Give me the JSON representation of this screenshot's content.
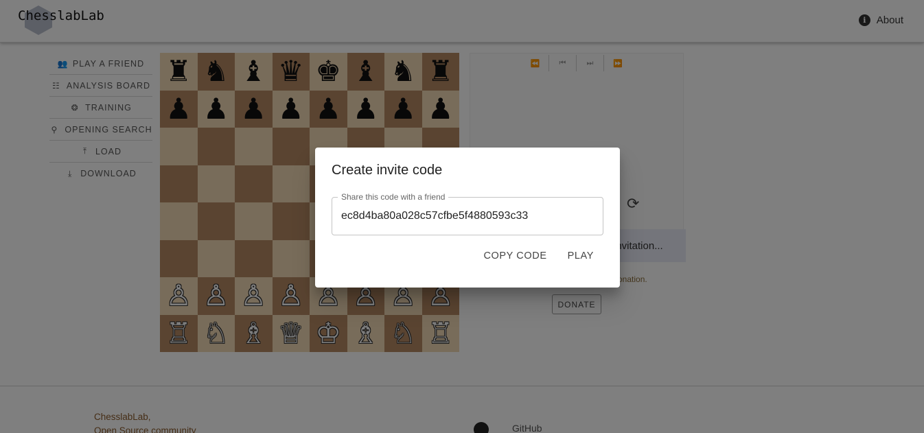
{
  "header": {
    "logo_text": "ChesslabLab",
    "about_label": "About"
  },
  "sidebar": {
    "items": [
      {
        "label": "PLAY A FRIEND",
        "icon": "people-icon"
      },
      {
        "label": "ANALYSIS BOARD",
        "icon": "tune-icon"
      },
      {
        "label": "TRAINING",
        "icon": "brain-icon"
      },
      {
        "label": "OPENING SEARCH",
        "icon": "search-icon"
      },
      {
        "label": "LOAD",
        "icon": "upload-icon"
      },
      {
        "label": "DOWNLOAD",
        "icon": "download-icon"
      }
    ]
  },
  "board": {
    "ranks": [
      [
        "♜",
        "♞",
        "♝",
        "♛",
        "♚",
        "♝",
        "♞",
        "♜"
      ],
      [
        "♟",
        "♟",
        "♟",
        "♟",
        "♟",
        "♟",
        "♟",
        "♟"
      ],
      [
        "",
        "",
        "",
        "",
        "",
        "",
        "",
        ""
      ],
      [
        "",
        "",
        "",
        "",
        "",
        "",
        "",
        ""
      ],
      [
        "",
        "",
        "",
        "",
        "",
        "",
        "",
        ""
      ],
      [
        "",
        "",
        "",
        "",
        "",
        "",
        "",
        ""
      ],
      [
        "♙",
        "♙",
        "♙",
        "♙",
        "♙",
        "♙",
        "♙",
        "♙"
      ],
      [
        "♖",
        "♘",
        "♗",
        "♕",
        "♔",
        "♗",
        "♘",
        "♖"
      ]
    ],
    "light_color": "#f0d9b5",
    "dark_color": "#b58863"
  },
  "panel": {
    "nav": [
      "⏪",
      "⏮",
      "⏭",
      "⏩"
    ],
    "flip_icon": "⟳",
    "invite_text": "invitation...",
    "donation_text": "onation.",
    "donate_label": "DONATE"
  },
  "footer": {
    "brand_line1": "ChesslabLab,",
    "brand_line2": "Open Source community",
    "github_label": "GitHub"
  },
  "modal": {
    "title": "Create invite code",
    "field_label": "Share this code with a friend",
    "field_value": "ec8d4ba80a028c57cfbe5f4880593c33",
    "copy_label": "COPY CODE",
    "play_label": "PLAY"
  }
}
